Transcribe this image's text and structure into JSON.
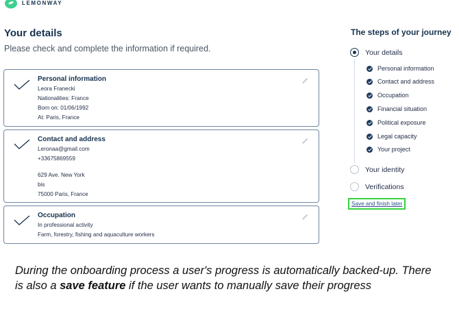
{
  "brand": {
    "name": "LEMONWAY"
  },
  "header": {
    "title": "Your details",
    "subtitle": "Please check and complete the information if required."
  },
  "cards": [
    {
      "title": "Personal information",
      "lines": [
        "Leora Franecki",
        "Nationalities: France",
        "Born on: 01/06/1992",
        "At: Paris, France"
      ]
    },
    {
      "title": "Contact and address",
      "lines": [
        "Leronaa@gmail.com",
        "+33675869559"
      ],
      "address_lines": [
        "629 Ave. New York",
        "bis",
        "75000 Paris, France"
      ]
    },
    {
      "title": "Occupation",
      "lines": [
        "In professional activity",
        "Farm, forestry, fishing and aquaculture workers"
      ]
    }
  ],
  "steps": {
    "title": "The steps of your journey",
    "main": [
      {
        "label": "Your details",
        "state": "active"
      },
      {
        "label": "Your identity",
        "state": "pending"
      },
      {
        "label": "Verifications",
        "state": "pending"
      }
    ],
    "sub_steps": [
      "Personal information",
      "Contact and address",
      "Occupation",
      "Financial situation",
      "Political exposure",
      "Legal capacity",
      "Your project"
    ],
    "save_link": "Save and finish later"
  },
  "caption": {
    "part1": "During the onboarding process a user's progress is automatically backed-up. There is also a ",
    "bold": "save feature",
    "part2": " if the user wants to manually save their progress"
  },
  "colors": {
    "navy": "#16324f",
    "card_border": "#6f86a3",
    "highlight": "#37d23c",
    "link": "#2a4f8a",
    "logo_green": "#3ecf8e"
  },
  "icons": {
    "check": "check-icon",
    "edit": "pencil-icon",
    "logo": "leaf-logo"
  }
}
